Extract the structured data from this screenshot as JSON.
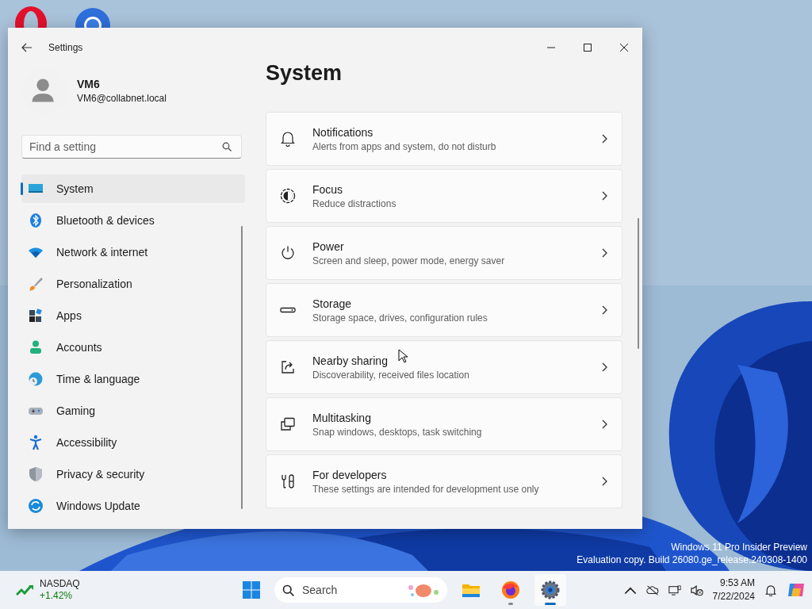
{
  "window": {
    "title": "Settings"
  },
  "user": {
    "name": "VM6",
    "email": "VM6@collabnet.local"
  },
  "search": {
    "placeholder": "Find a setting"
  },
  "nav": [
    {
      "label": "System",
      "selected": true
    },
    {
      "label": "Bluetooth & devices",
      "selected": false
    },
    {
      "label": "Network & internet",
      "selected": false
    },
    {
      "label": "Personalization",
      "selected": false
    },
    {
      "label": "Apps",
      "selected": false
    },
    {
      "label": "Accounts",
      "selected": false
    },
    {
      "label": "Time & language",
      "selected": false
    },
    {
      "label": "Gaming",
      "selected": false
    },
    {
      "label": "Accessibility",
      "selected": false
    },
    {
      "label": "Privacy & security",
      "selected": false
    },
    {
      "label": "Windows Update",
      "selected": false
    }
  ],
  "page_title": "System",
  "settings": [
    {
      "title": "Notifications",
      "description": "Alerts from apps and system, do not disturb"
    },
    {
      "title": "Focus",
      "description": "Reduce distractions"
    },
    {
      "title": "Power",
      "description": "Screen and sleep, power mode, energy saver"
    },
    {
      "title": "Storage",
      "description": "Storage space, drives, configuration rules"
    },
    {
      "title": "Nearby sharing",
      "description": "Discoverability, received files location"
    },
    {
      "title": "Multitasking",
      "description": "Snap windows, desktops, task switching"
    },
    {
      "title": "For developers",
      "description": "These settings are intended for development use only"
    }
  ],
  "watermark": [
    "Windows 11 Pro Insider Preview",
    "Evaluation copy. Build 26080.ge_release.240308-1400"
  ],
  "taskbar": {
    "widget": {
      "name": "NASDAQ",
      "change": "+1.42%"
    },
    "search_placeholder": "Search",
    "apps": [
      {
        "running": false,
        "selected": false
      },
      {
        "running": true,
        "selected": false
      },
      {
        "running": true,
        "selected": true
      }
    ],
    "time": "9:53 AM",
    "date": "7/22/2024"
  }
}
